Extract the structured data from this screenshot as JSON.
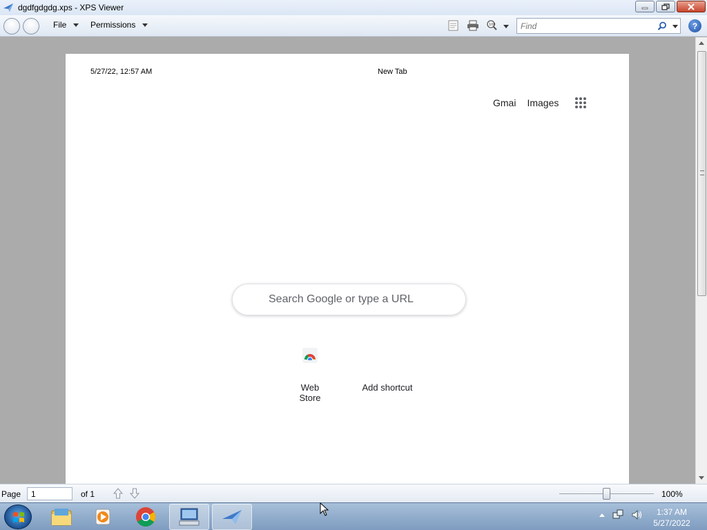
{
  "window": {
    "title": "dgdfgdgdg.xps - XPS Viewer"
  },
  "toolbar": {
    "menus": [
      {
        "label": "File"
      },
      {
        "label": "Permissions"
      }
    ],
    "find_placeholder": "Find",
    "icons": [
      "outline-icon",
      "print-icon",
      "zoom-icon",
      "search-icon",
      "help-icon"
    ]
  },
  "document": {
    "header_datetime": "5/27/22, 12:57 AM",
    "header_title": "New Tab",
    "links": {
      "gmail": "Gmai",
      "images": "Images"
    },
    "search_placeholder": "Search Google or type a URL",
    "shortcuts": [
      {
        "label": "Web Store"
      },
      {
        "label": "Add shortcut"
      }
    ]
  },
  "statusbar": {
    "page_label": "Page",
    "page_value": "1",
    "of_label": "of 1",
    "zoom": "100%",
    "zoom_level_fraction": 0.46
  },
  "taskbar": {
    "time": "1:37 AM",
    "date": "5/27/2022"
  },
  "colors": {
    "doc_background": "#ababab",
    "taskbar": "#8fabd0",
    "help": "#2a5db0"
  }
}
